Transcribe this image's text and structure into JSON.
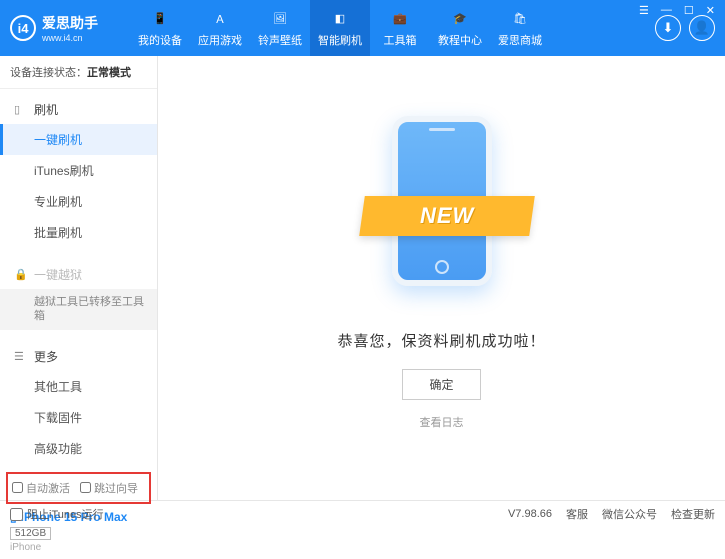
{
  "header": {
    "app_name": "爱思助手",
    "url": "www.i4.cn",
    "nav": [
      {
        "label": "我的设备"
      },
      {
        "label": "应用游戏"
      },
      {
        "label": "铃声壁纸"
      },
      {
        "label": "智能刷机"
      },
      {
        "label": "工具箱"
      },
      {
        "label": "教程中心"
      },
      {
        "label": "爱思商城"
      }
    ]
  },
  "status": {
    "label": "设备连接状态：",
    "value": "正常模式"
  },
  "sidebar": {
    "flash": {
      "title": "刷机",
      "items": [
        "一键刷机",
        "iTunes刷机",
        "专业刷机",
        "批量刷机"
      ]
    },
    "jailbreak": {
      "title": "一键越狱",
      "note": "越狱工具已转移至工具箱"
    },
    "more": {
      "title": "更多",
      "items": [
        "其他工具",
        "下载固件",
        "高级功能"
      ]
    },
    "checkboxes": {
      "auto_activate": "自动激活",
      "skip_guide": "跳过向导"
    },
    "device": {
      "name": "iPhone 15 Pro Max",
      "storage": "512GB",
      "type": "iPhone"
    }
  },
  "main": {
    "ribbon": "NEW",
    "message": "恭喜您，保资料刷机成功啦！",
    "ok": "确定",
    "view_log": "查看日志"
  },
  "footer": {
    "block_itunes": "阻止iTunes运行",
    "version": "V7.98.66",
    "service": "客服",
    "wechat": "微信公众号",
    "update": "检查更新"
  }
}
